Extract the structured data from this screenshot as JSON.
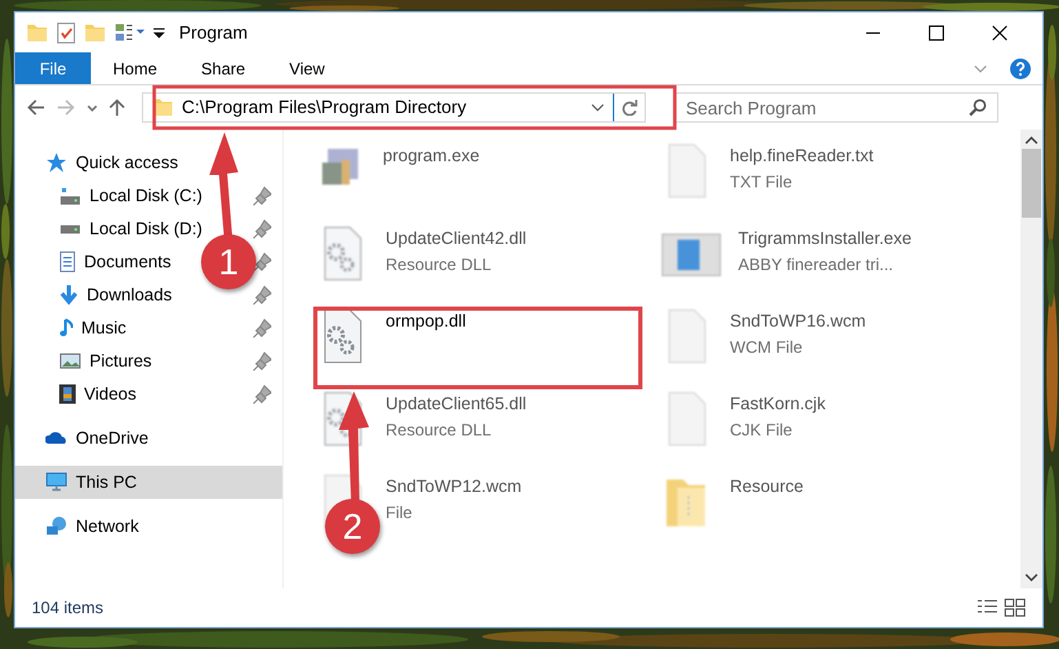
{
  "window": {
    "title": "Program"
  },
  "ribbon_tabs": [
    {
      "label": "File",
      "selected": true
    },
    {
      "label": "Home",
      "selected": false
    },
    {
      "label": "Share",
      "selected": false
    },
    {
      "label": "View",
      "selected": false
    }
  ],
  "address_bar": {
    "path": "C:\\Program Files\\Program Directory"
  },
  "search": {
    "placeholder": "Search Program"
  },
  "sidebar": {
    "items": [
      {
        "label": "Quick access",
        "kind": "group",
        "selected": false,
        "children": [
          {
            "label": "Local Disk (C:)",
            "pinned": true
          },
          {
            "label": "Local Disk (D:)",
            "pinned": true
          },
          {
            "label": "Documents",
            "pinned": true
          },
          {
            "label": "Downloads",
            "pinned": true
          },
          {
            "label": "Music",
            "pinned": true
          },
          {
            "label": "Pictures",
            "pinned": true
          },
          {
            "label": "Videos",
            "pinned": true
          }
        ]
      },
      {
        "label": "OneDrive",
        "kind": "group",
        "selected": false
      },
      {
        "label": "This PC",
        "kind": "group",
        "selected": true
      },
      {
        "label": "Network",
        "kind": "group",
        "selected": false
      }
    ]
  },
  "files": [
    {
      "name": "program.exe",
      "blurred": true
    },
    {
      "name": "help.fineReader.txt",
      "type": "TXT File",
      "blurred": true
    },
    {
      "name": "UpdateClient42.dll",
      "type": "Resource DLL",
      "blurred": true
    },
    {
      "name": "TrigrammsInstaller.exe",
      "type": "ABBY finereader tri...",
      "blurred": true
    },
    {
      "name": "ormpop.dll",
      "blurred": false
    },
    {
      "name": "SndToWP16.wcm",
      "type": "WCM File",
      "blurred": true
    },
    {
      "name": "UpdateClient65.dll",
      "type": "Resource DLL",
      "blurred": true
    },
    {
      "name": "FastKorn.cjk",
      "type": "CJK File",
      "blurred": true
    },
    {
      "name": "SndToWP12.wcm",
      "type": "File",
      "blurred": true
    },
    {
      "name": "Resource",
      "blurred": true
    }
  ],
  "status_bar": {
    "count": "104 items"
  },
  "annotations": [
    {
      "label": "1"
    },
    {
      "label": "2"
    }
  ]
}
